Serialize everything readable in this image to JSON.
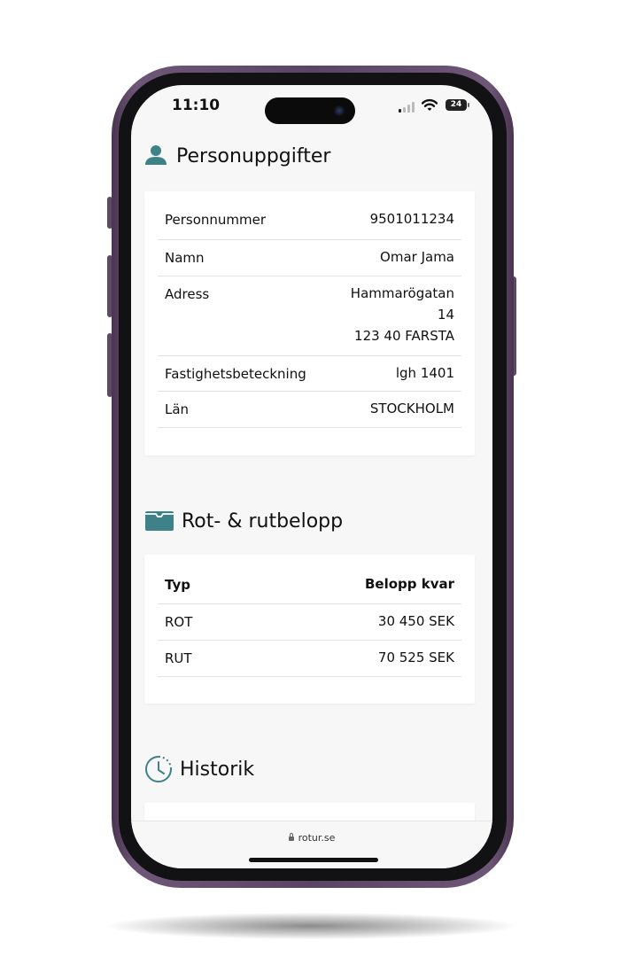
{
  "status": {
    "time": "11:10",
    "battery": "24"
  },
  "accent_color": "#3e8189",
  "sections": {
    "personal": {
      "title": "Personuppgifter",
      "icon": "person-icon",
      "rows": [
        {
          "label": "Personnummer",
          "value_lines": [
            "9501011234"
          ]
        },
        {
          "label": "Namn",
          "value_lines": [
            "Omar Jama"
          ]
        },
        {
          "label": "Adress",
          "value_lines": [
            "Hammarögatan",
            "14",
            "123 40 FARSTA"
          ]
        },
        {
          "label": "Fastighetsbeteckning",
          "value_lines": [
            "lgh 1401"
          ]
        },
        {
          "label": "Län",
          "value_lines": [
            "STOCKHOLM"
          ]
        }
      ]
    },
    "rot": {
      "title": "Rot- & rutbelopp",
      "icon": "wallet-icon",
      "header": {
        "type": "Typ",
        "amount": "Belopp kvar"
      },
      "rows": [
        {
          "type": "ROT",
          "amount": "30 450 SEK"
        },
        {
          "type": "RUT",
          "amount": "70 525 SEK"
        }
      ]
    },
    "history": {
      "title": "Historik",
      "icon": "clock-history-icon"
    }
  },
  "browser": {
    "url": "rotur.se"
  }
}
